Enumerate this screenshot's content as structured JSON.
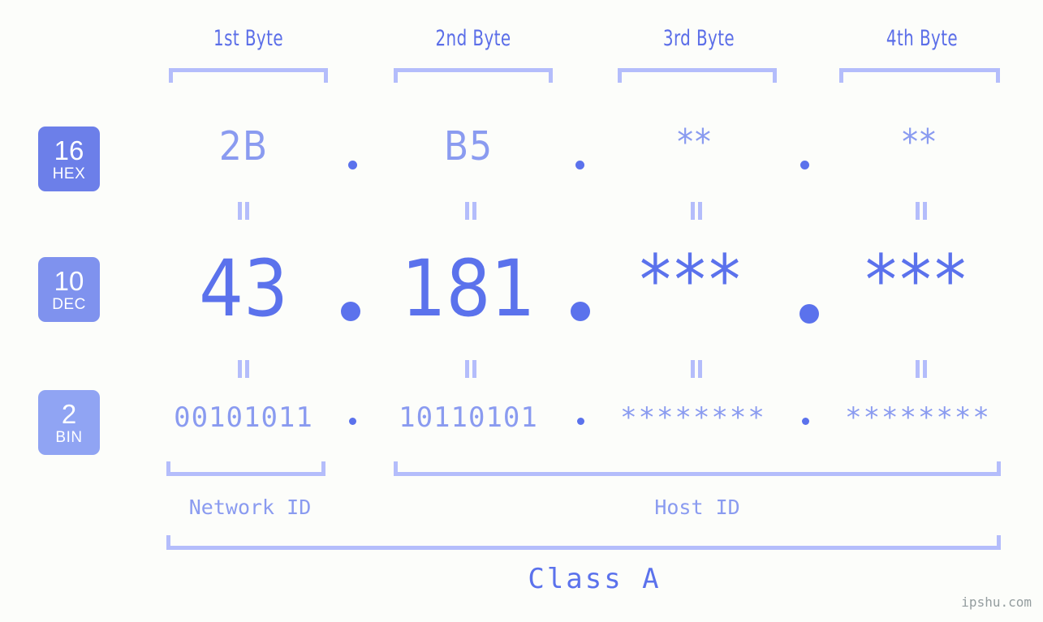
{
  "page": {
    "background_color": "#fcfdfa",
    "accent_color": "#5b72ec",
    "accent_light_color": "#8a9bf0",
    "bracket_color": "#b4bdfb",
    "watermark": "ipshu.com"
  },
  "byte_headers": [
    {
      "label": "1st Byte"
    },
    {
      "label": "2nd Byte"
    },
    {
      "label": "3rd Byte"
    },
    {
      "label": "4th Byte"
    }
  ],
  "bases": [
    {
      "number": "16",
      "name": "HEX",
      "color": "#6c7fe9"
    },
    {
      "number": "10",
      "name": "DEC",
      "color": "#7f92ee"
    },
    {
      "number": "2",
      "name": "BIN",
      "color": "#90a4f3"
    }
  ],
  "rows": {
    "hex": {
      "base_number": "16",
      "base_name": "HEX",
      "bytes": [
        "2B",
        "B5",
        "**",
        "**"
      ],
      "separator": "."
    },
    "dec": {
      "base_number": "10",
      "base_name": "DEC",
      "bytes": [
        "43",
        "181",
        "***",
        "***"
      ],
      "separator": "."
    },
    "bin": {
      "base_number": "2",
      "base_name": "BIN",
      "bytes": [
        "00101011",
        "10110101",
        "********",
        "********"
      ],
      "separator": "."
    }
  },
  "equals_marks": {
    "symbol": "=",
    "count_per_row": 4,
    "rows": 2
  },
  "sections": [
    {
      "label": "Network ID"
    },
    {
      "label": "Host ID"
    }
  ],
  "class": {
    "label": "Class A"
  }
}
